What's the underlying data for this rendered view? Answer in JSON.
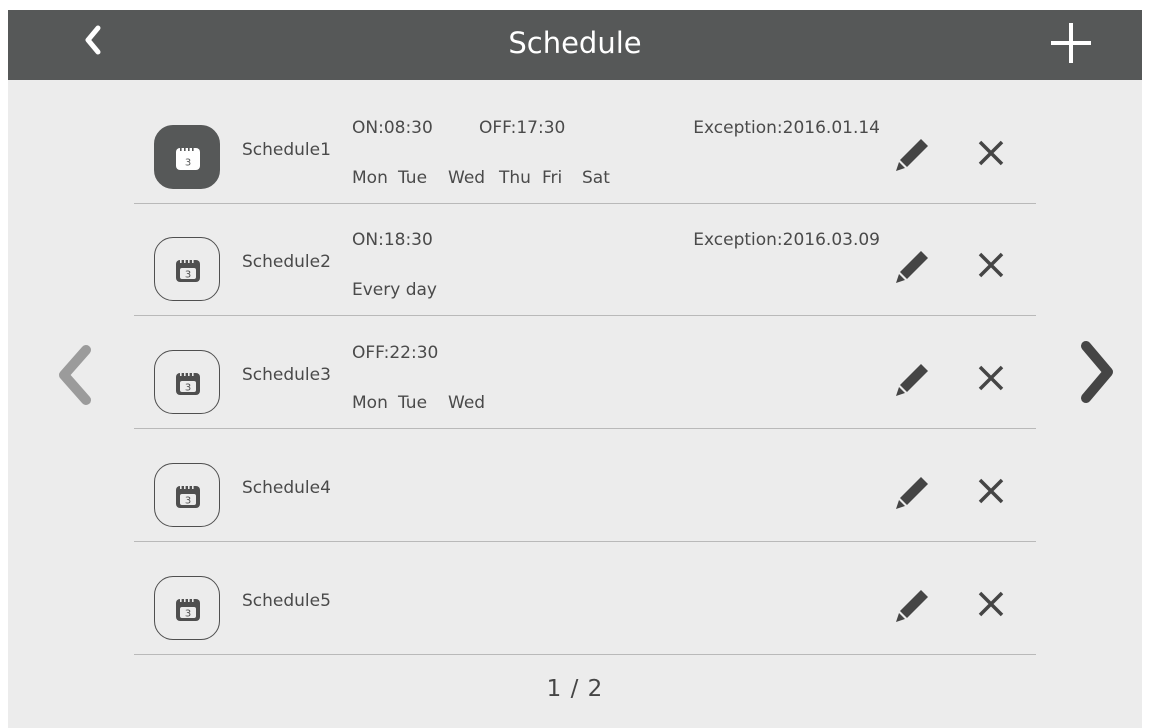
{
  "header": {
    "title": "Schedule",
    "back_icon": "chevron-left-icon",
    "add_icon": "plus-icon"
  },
  "pager": {
    "prev_icon": "chevron-left-icon",
    "next_icon": "chevron-right-icon",
    "indicator": "1 / 2"
  },
  "schedules": [
    {
      "name": "Schedule1",
      "active": true,
      "calendar_day": "3",
      "on": "ON:08:30",
      "off": "OFF:17:30",
      "exception": "Exception:2016.01.14",
      "days": [
        "Mon",
        "Tue",
        "Wed",
        "Thu",
        "Fri",
        "Sat"
      ],
      "days_text": ""
    },
    {
      "name": "Schedule2",
      "active": false,
      "calendar_day": "3",
      "on": "ON:18:30",
      "off": "",
      "exception": "Exception:2016.03.09",
      "days": [],
      "days_text": "Every day"
    },
    {
      "name": "Schedule3",
      "active": false,
      "calendar_day": "3",
      "on": "",
      "off": "OFF:22:30",
      "exception": "",
      "days": [
        "Mon",
        "Tue",
        "Wed"
      ],
      "days_text": ""
    },
    {
      "name": "Schedule4",
      "active": false,
      "calendar_day": "3",
      "on": "",
      "off": "",
      "exception": "",
      "days": [],
      "days_text": ""
    },
    {
      "name": "Schedule5",
      "active": false,
      "calendar_day": "3",
      "on": "",
      "off": "",
      "exception": "",
      "days": [],
      "days_text": ""
    }
  ],
  "colors": {
    "header_bg": "#565858",
    "page_bg": "#ececec",
    "text": "#4a4a4a",
    "divider": "#b9b9b9"
  }
}
